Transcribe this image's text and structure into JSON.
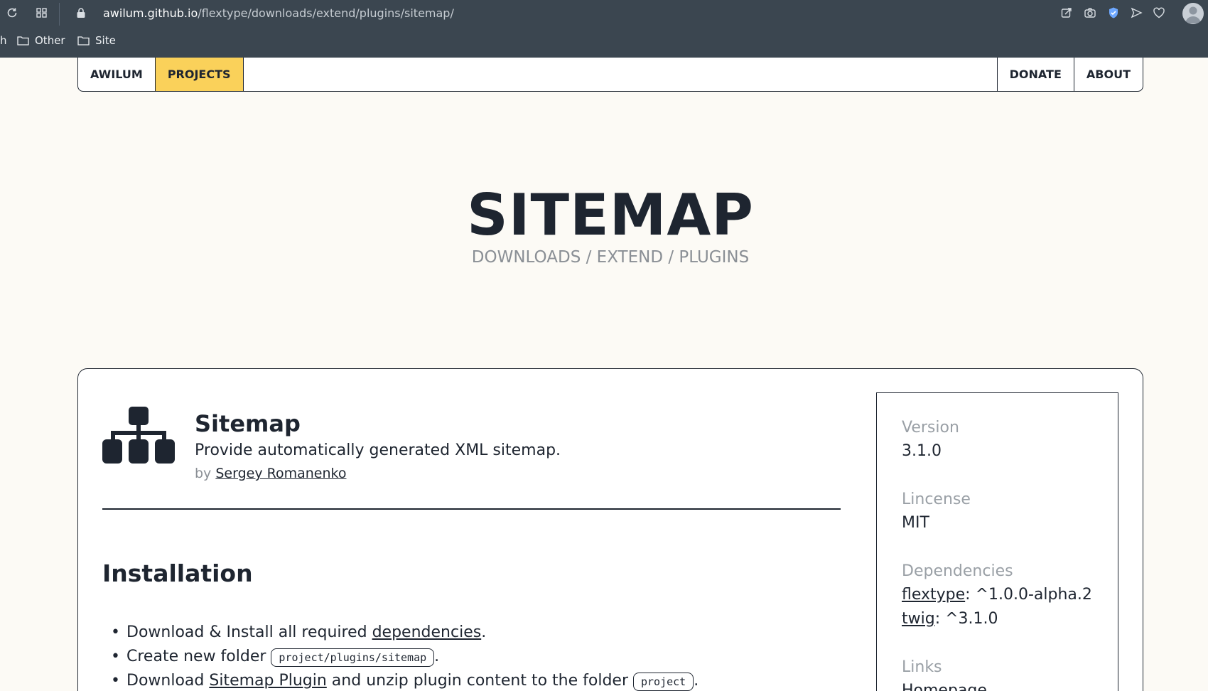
{
  "browser": {
    "url_host": "awilum.github.io",
    "url_path": "/flextype/downloads/extend/plugins/sitemap/",
    "bookmarks": [
      "h",
      "Other",
      "Site"
    ]
  },
  "nav": {
    "brand": "AWILUM",
    "projects": "PROJECTS",
    "donate": "DONATE",
    "about": "ABOUT"
  },
  "hero": {
    "title": "SITEMAP",
    "breadcrumb": "DOWNLOADS / EXTEND / PLUGINS"
  },
  "plugin": {
    "name": "Sitemap",
    "description": "Provide automatically generated XML sitemap.",
    "by": "by",
    "author": "Sergey Romanenko"
  },
  "installation": {
    "heading": "Installation",
    "step1_prefix": "Download & Install all required ",
    "step1_link": "dependencies",
    "step1_suffix": ".",
    "step2_prefix": "Create new folder ",
    "step2_code": "project/plugins/sitemap",
    "step2_suffix": ".",
    "step3_prefix": "Download ",
    "step3_link": "Sitemap Plugin",
    "step3_middle": " and unzip plugin content to the folder ",
    "step3_code": "project",
    "step3_suffix": "."
  },
  "sidebar": {
    "version_label": "Version",
    "version_value": "3.1.0",
    "license_label": "Lincense",
    "license_value": "MIT",
    "dependencies_label": "Dependencies",
    "dep1_name": "flextype",
    "dep1_version": ": ^1.0.0-alpha.2",
    "dep2_name": "twig",
    "dep2_version": ": ^3.1.0",
    "links_label": "Links",
    "links_first": "Homepage"
  },
  "colors": {
    "accent": "#fad15a",
    "text": "#1e2530",
    "background": "#fcfaf5",
    "chrome": "#3b4650"
  }
}
